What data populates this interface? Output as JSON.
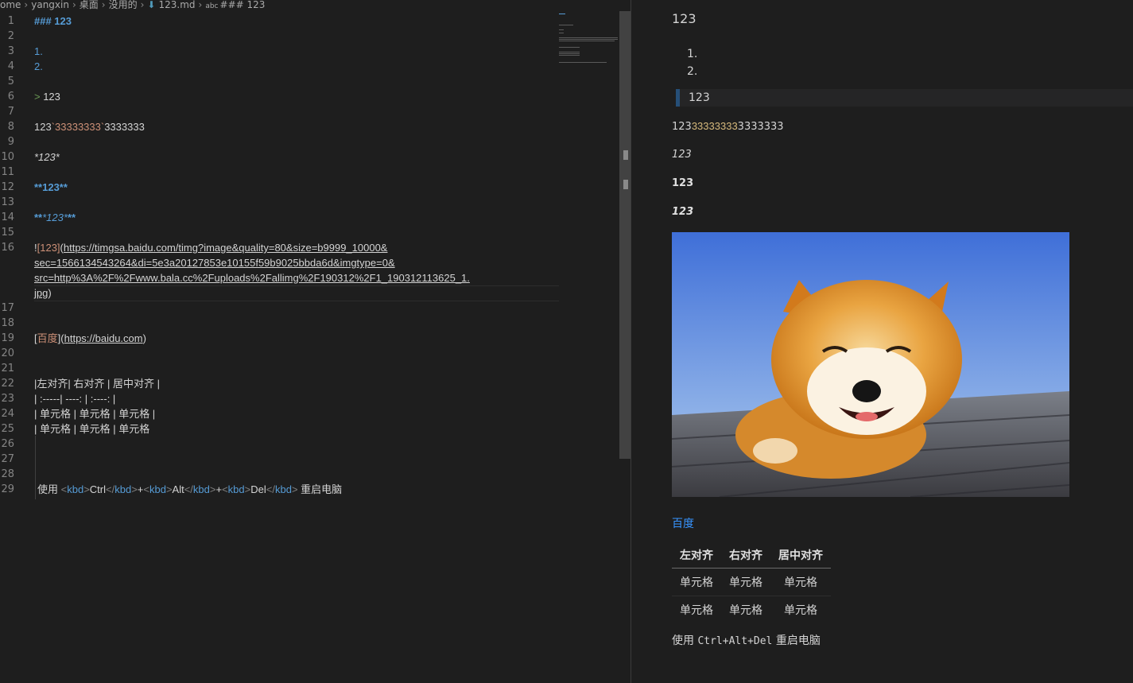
{
  "breadcrumb": {
    "parts": [
      "ome",
      "yangxin",
      "桌面",
      "没用的"
    ],
    "file": "123.md",
    "symbol_prefix": "abc",
    "symbol": "### 123"
  },
  "editor": {
    "line_numbers": [
      "1",
      "2",
      "3",
      "4",
      "5",
      "6",
      "7",
      "8",
      "9",
      "10",
      "11",
      "12",
      "13",
      "14",
      "15",
      "16",
      "17",
      "18",
      "19",
      "20",
      "21",
      "22",
      "23",
      "24",
      "25",
      "26",
      "27",
      "28",
      "29"
    ],
    "lines": {
      "l1": "### 123",
      "l3": "1.",
      "l4": "2.",
      "l6_marker": ">",
      "l6_text": " 123",
      "l8_a": "123",
      "l8_code": "`33333333`",
      "l8_b": "3333333",
      "l10": "*123*",
      "l12": "**123**",
      "l14_a": "**",
      "l14_b": "*123*",
      "l14_c": "**",
      "l16_bang": "!",
      "l16_alt": "[123]",
      "l16_paren": "(",
      "l16_url1": "https://timgsa.baidu.com/timg?image&quality=80&size=b9999_10000&",
      "l16_url2": "sec=1566134543264&di=5e3a20127853e10155f59b9025bbda6d&imgtype=0&",
      "l16_url3": "src=http%3A%2F%2Fwww.bala.cc%2Fuploads%2Fallimg%2F190312%2F1_190312113625_1.",
      "l16_url4": "jpg",
      "l16_close": ")",
      "l19_bracket_open": "[",
      "l19_text": "百度",
      "l19_bracket_close": "]",
      "l19_paren_open": "(",
      "l19_url": "https://baidu.com",
      "l19_paren_close": ")",
      "l22": "|左对齐| 右对齐 | 居中对齐 |",
      "l23": "| :-----| ----: | :----: |",
      "l24": "| 单元格 | 单元格 | 单元格 |",
      "l25": "| 单元格 | 单元格 | 单元格",
      "l29_pre": "使用 ",
      "l29_key1": "Ctrl",
      "l29_plus1": "+",
      "l29_key2": "Alt",
      "l29_plus2": "+",
      "l29_key3": "Del",
      "l29_post": " 重启电脑",
      "tag_open": "<",
      "tag_close_open": "</",
      "tag_end": ">",
      "tag_name": "kbd"
    }
  },
  "preview": {
    "heading": "123",
    "list": [
      "1.",
      "2."
    ],
    "blockquote": "123",
    "code_line_pre": "123",
    "code_line_code": "33333333",
    "code_line_post": "3333333",
    "em": "123",
    "strong": "123",
    "strong_em": "123",
    "image_alt": "123",
    "link": "百度",
    "table": {
      "headers": [
        "左对齐",
        "右对齐",
        "居中对齐"
      ],
      "rows": [
        [
          "单元格",
          "单元格",
          "单元格"
        ],
        [
          "单元格",
          "单元格",
          "单元格"
        ]
      ]
    },
    "kbd_line": {
      "pre": "使用 ",
      "keys": "Ctrl+Alt+Del",
      "post": " 重启电脑"
    }
  },
  "colors": {
    "background": "#1e1e1e",
    "heading_blue": "#569cd6",
    "string_orange": "#ce9178",
    "link_blue": "#3794ff",
    "inline_code_yellow": "#d7ba7d"
  }
}
